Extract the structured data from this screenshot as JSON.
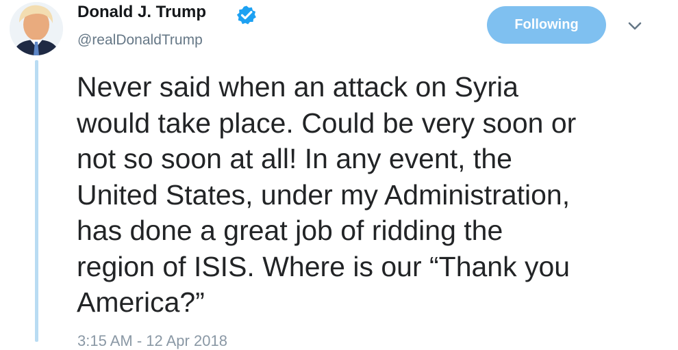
{
  "author": {
    "display_name": "Donald J. Trump",
    "username": "@realDonaldTrump",
    "verified": true,
    "avatar_icon": "profile-photo"
  },
  "actions": {
    "follow_label": "Following",
    "more_icon": "chevron-down-icon"
  },
  "tweet": {
    "lines": [
      "Never said when an attack on Syria",
      "would take place. Could be very soon or",
      "not so soon at all! In any event, the",
      "United States, under my Administration,",
      "has done a great job of ridding the",
      "region of ISIS. Where is our “Thank you",
      "America?”"
    ],
    "timestamp": "3:15 AM - 12 Apr 2018"
  },
  "colors": {
    "follow_button": "#7fc0f0",
    "verified": "#1da1f2",
    "thread_line": "#b9dcf3",
    "secondary_text": "#657786"
  }
}
